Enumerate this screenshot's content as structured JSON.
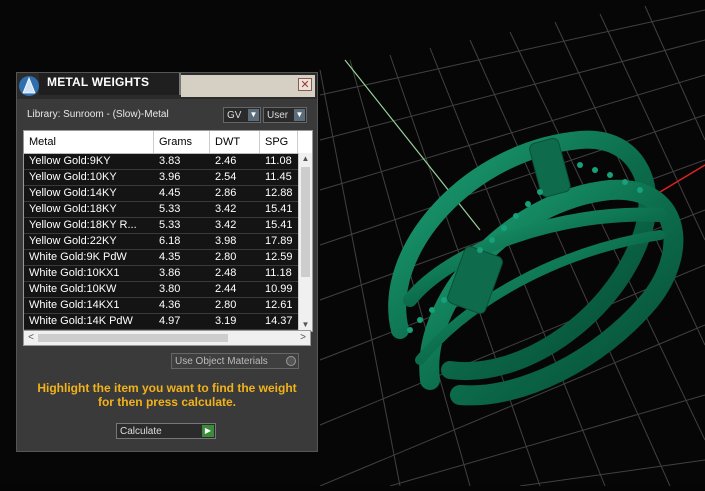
{
  "dialog": {
    "title": "METAL WEIGHTS",
    "close_symbol": "✕",
    "library_label": "Library: Sunroom - (Slow)-Metal",
    "combo_gv": "GV",
    "combo_user": "User",
    "use_object_materials": "Use Object Materials",
    "instruction_line1": "Highlight the item you want to find the weight",
    "instruction_line2": "for then press calculate.",
    "calculate_label": "Calculate"
  },
  "table": {
    "headers": [
      "Metal",
      "Grams",
      "DWT",
      "SPG"
    ],
    "rows": [
      [
        "Yellow Gold:9KY",
        "3.83",
        "2.46",
        "11.08"
      ],
      [
        "Yellow Gold:10KY",
        "3.96",
        "2.54",
        "11.45"
      ],
      [
        "Yellow Gold:14KY",
        "4.45",
        "2.86",
        "12.88"
      ],
      [
        "Yellow Gold:18KY",
        "5.33",
        "3.42",
        "15.41"
      ],
      [
        "Yellow Gold:18KY R...",
        "5.33",
        "3.42",
        "15.41"
      ],
      [
        "Yellow Gold:22KY",
        "6.18",
        "3.98",
        "17.89"
      ],
      [
        "White Gold:9K PdW",
        "4.35",
        "2.80",
        "12.59"
      ],
      [
        "White Gold:10KX1",
        "3.86",
        "2.48",
        "11.18"
      ],
      [
        "White Gold:10KW",
        "3.80",
        "2.44",
        "10.99"
      ],
      [
        "White Gold:14KX1",
        "4.36",
        "2.80",
        "12.61"
      ],
      [
        "White Gold:14K PdW",
        "4.97",
        "3.19",
        "14.37"
      ]
    ]
  },
  "icons": {
    "logo": "app-logo-icon",
    "close": "close-icon",
    "dropdown": "chevron-down-icon",
    "go": "play-icon"
  },
  "colors": {
    "ring": "#0f7a56",
    "accent_text": "#f2b31a",
    "panel": "#3a3a3a"
  }
}
